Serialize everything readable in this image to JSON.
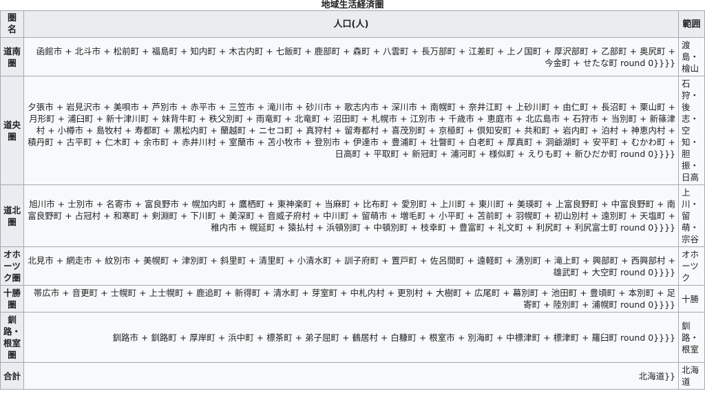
{
  "caption": "地域生活経済圏",
  "headers": {
    "col1": "圏名",
    "col2": "人口(人)",
    "col3": "範囲"
  },
  "rows": [
    {
      "name": "道南圏",
      "population": "函館市 + 北斗市 + 松前町 + 福島町 + 知内町 + 木古内町 + 七飯町 + 鹿部町 + 森町 + 八雲町 + 長万部町 + 江差町 + 上ノ国町 + 厚沢部町 + 乙部町 + 奥尻町 + 今金町 + せたな町 round 0}}}}",
      "range": "渡島・檜山"
    },
    {
      "name": "道央圏",
      "population": "夕張市 + 岩見沢市 + 美唄市 + 芦別市 + 赤平市 + 三笠市 + 滝川市 + 砂川市 + 歌志内市 + 深川市 + 南幌町 + 奈井江町 + 上砂川町 + 由仁町 + 長沼町 + 栗山町 + 月形町 + 浦臼町 + 新十津川町 + 妹背牛町 + 秩父別町 + 雨竜町 + 北竜町 + 沼田町 + 札幌市 + 江別市 + 千歳市 + 恵庭市 + 北広島市 + 石狩市 + 当別町 + 新篠津村 + 小樽市 + 島牧村 + 寿都町 + 黒松内町 + 蘭越町 + ニセコ町 + 真狩村 + 留寿都村 + 喜茂別町 + 京極町 + 倶知安町 + 共和町 + 岩内町 + 泊村 + 神恵内村 + 積丹町 + 古平町 + 仁木町 + 余市町 + 赤井川村 + 室蘭市 + 苫小牧市 + 登別市 + 伊達市 + 豊浦町 + 壮瞥町 + 白老町 + 厚真町 + 洞爺湖町 + 安平町 + むかわ町 + 日高町 + 平取町 + 新冠町 + 浦河町 + 様似町 + えりも町 + 新ひだか町 round 0}}}}",
      "range": "石狩・後志・空知・胆振・日高"
    },
    {
      "name": "道北圏",
      "population": "旭川市 + 士別市 + 名寄市 + 富良野市 + 幌加内町 + 鷹栖町 + 東神楽町 + 当麻町 + 比布町 + 愛別町 + 上川町 + 東川町 + 美瑛町 + 上富良野町 + 中富良野町 + 南富良野町 + 占冠村 + 和寒町 + 剣淵町 + 下川町 + 美深町 + 音威子府村 + 中川町 + 留萌市 + 増毛町 + 小平町 + 苫前町 + 羽幌町 + 初山別村 + 遠別町 + 天塩町 + 稚内市 + 幌延町 + 猿払村 + 浜頓別町 + 中頓別町 + 枝幸町 + 豊富町 + 礼文町 + 利尻町 + 利尻富士町 round 0}}}}",
      "range": "上川・留萌・宗谷"
    },
    {
      "name": "オホーツク圏",
      "population": "北見市 + 網走市 + 紋別市 + 美幌町 + 津別町 + 斜里町 + 清里町 + 小清水町 + 訓子府町 + 置戸町 + 佐呂間町 + 遠軽町 + 湧別町 + 滝上町 + 興部町 + 西興部村 + 雄武町 + 大空町 round 0}}}}",
      "range": "オホーツク"
    },
    {
      "name": "十勝圏",
      "population": "帯広市 + 音更町 + 士幌町 + 上士幌町 + 鹿追町 + 新得町 + 清水町 + 芽室町 + 中札内村 + 更別村 + 大樹町 + 広尾町 + 幕別町 + 池田町 + 豊頃町 + 本別町 + 足寄町 + 陸別町 + 浦幌町 round 0}}}}",
      "range": "十勝"
    },
    {
      "name": "釧路・根室圏",
      "population": "釧路市 + 釧路町 + 厚岸町 + 浜中町 + 標茶町 + 弟子屈町 + 鶴居村 + 白糠町 + 根室市 + 別海町 + 中標津町 + 標津町 + 羅臼町 round 0}}}}",
      "range": "釧路・根室"
    },
    {
      "name": "合計",
      "population": "北海道}}",
      "range": "北海道"
    }
  ]
}
